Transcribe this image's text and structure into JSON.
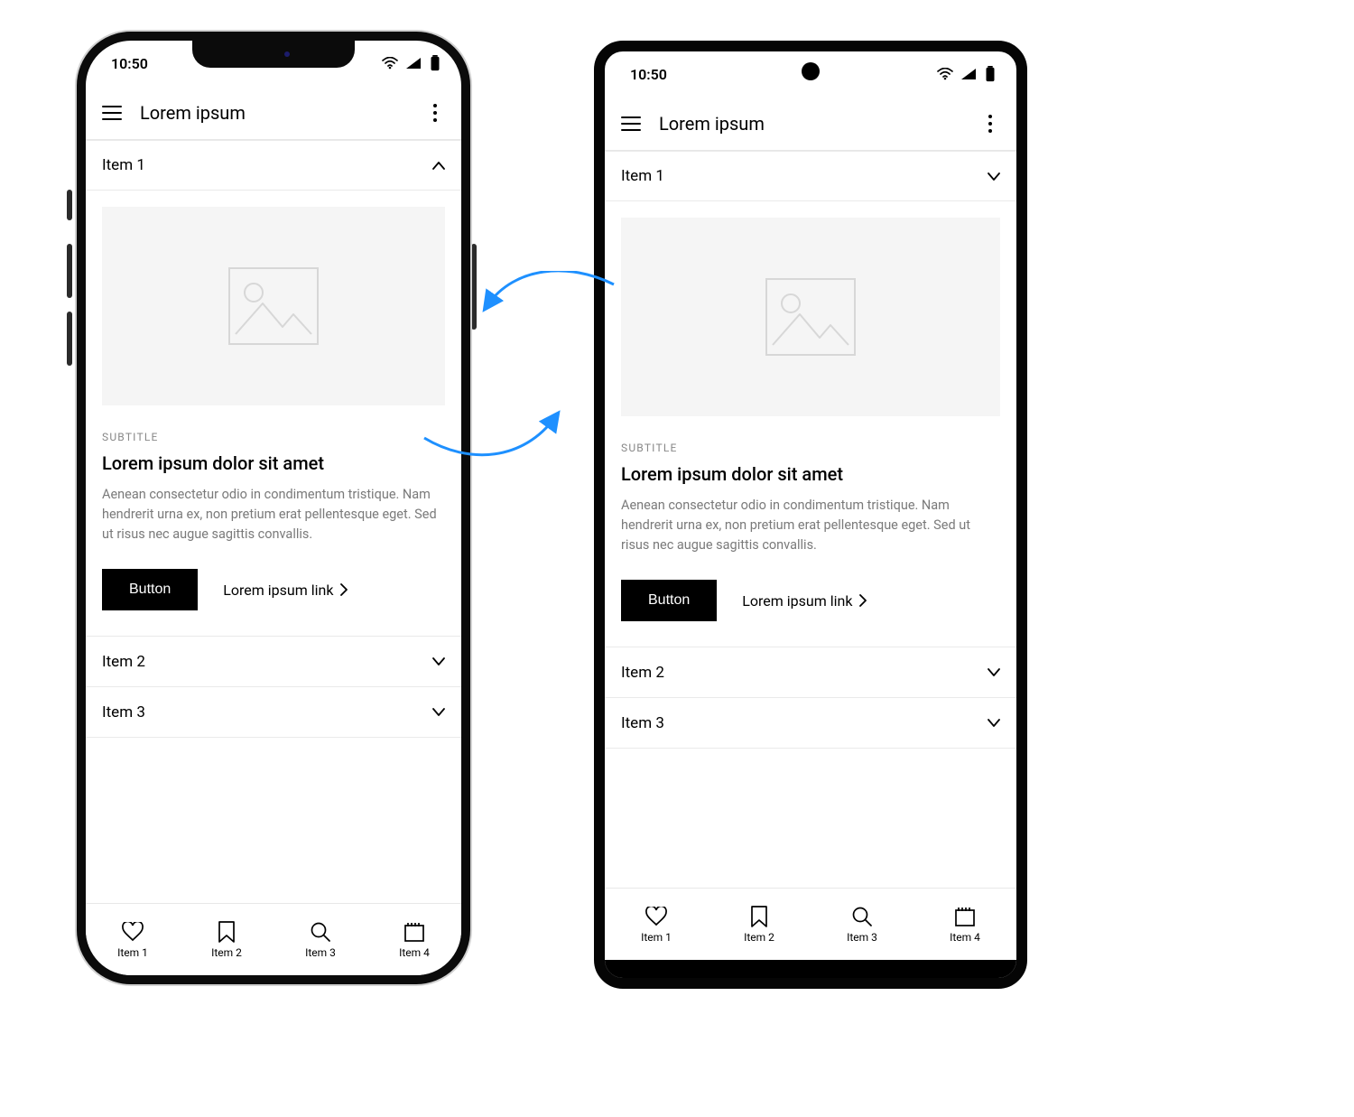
{
  "statusbar": {
    "time": "10:50"
  },
  "appbar": {
    "title": "Lorem ipsum"
  },
  "accordion": {
    "items": [
      {
        "label": "Item 1",
        "expanded": true
      },
      {
        "label": "Item 2",
        "expanded": false
      },
      {
        "label": "Item 3",
        "expanded": false
      }
    ]
  },
  "card": {
    "subtitle": "SUBTITLE",
    "title": "Lorem ipsum dolor sit amet",
    "body": "Aenean consectetur odio in condimentum tristique. Nam hendrerit urna ex, non pretium erat pellentesque eget. Sed ut risus nec augue sagittis convallis.",
    "button_label": "Button",
    "link_label": "Lorem ipsum link"
  },
  "bottomnav": {
    "items": [
      {
        "label": "Item 1",
        "icon": "heart"
      },
      {
        "label": "Item 2",
        "icon": "bookmark"
      },
      {
        "label": "Item 3",
        "icon": "search"
      },
      {
        "label": "Item 4",
        "icon": "calendar"
      }
    ]
  },
  "colors": {
    "arrow": "#1e90ff"
  }
}
